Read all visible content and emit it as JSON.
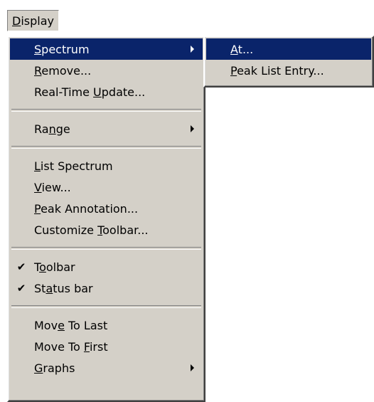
{
  "menubar": {
    "display": {
      "pre": "",
      "key": "D",
      "post": "isplay"
    }
  },
  "menu": {
    "spectrum": {
      "pre": "",
      "key": "S",
      "post": "pectrum"
    },
    "remove": {
      "pre": "",
      "key": "R",
      "post": "emove..."
    },
    "real_time_update": {
      "pre": "Real-Time ",
      "key": "U",
      "post": "pdate..."
    },
    "range": {
      "pre": "Ra",
      "key": "n",
      "post": "ge"
    },
    "list_spectrum": {
      "pre": "",
      "key": "L",
      "post": "ist Spectrum"
    },
    "view": {
      "pre": "",
      "key": "V",
      "post": "iew..."
    },
    "peak_annotation": {
      "pre": "",
      "key": "P",
      "post": "eak Annotation..."
    },
    "customize_toolbar": {
      "pre": "Customize ",
      "key": "T",
      "post": "oolbar..."
    },
    "toolbar": {
      "check": "✔",
      "pre": "T",
      "key": "o",
      "post": "olbar"
    },
    "status_bar": {
      "check": "✔",
      "pre": "St",
      "key": "a",
      "post": "tus bar"
    },
    "move_to_last": {
      "pre": "Mov",
      "key": "e",
      "post": " To Last"
    },
    "move_to_first": {
      "pre": "Move To ",
      "key": "F",
      "post": "irst"
    },
    "graphs": {
      "pre": "",
      "key": "G",
      "post": "raphs"
    }
  },
  "submenu": {
    "at": {
      "pre": "",
      "key": "A",
      "post": "t..."
    },
    "peak_list_entry": {
      "pre": "",
      "key": "P",
      "post": "eak List Entry..."
    }
  },
  "colors": {
    "menu_face": "#d4d0c8",
    "highlight": "#0a246a",
    "highlight_text": "#ffffff"
  }
}
